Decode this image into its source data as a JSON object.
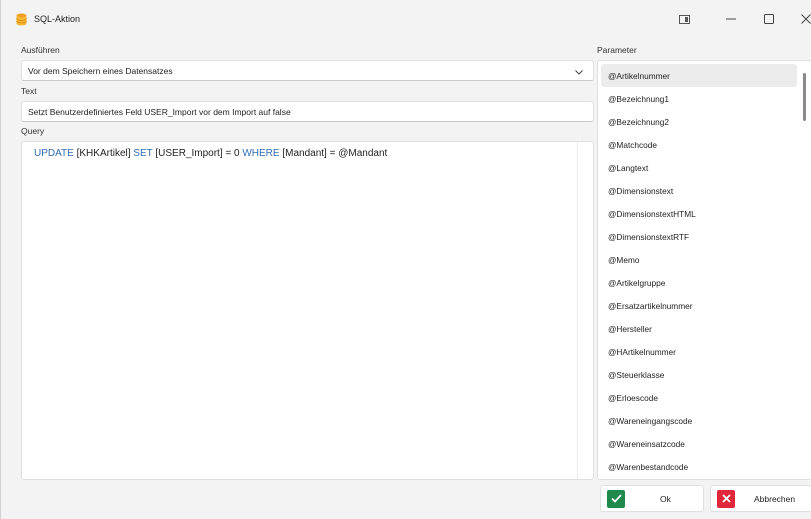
{
  "window": {
    "title": "SQL-Aktion",
    "app_icon": "database-icon",
    "controls": [
      "snap-layout-icon",
      "minimize-icon",
      "maximize-icon",
      "close-icon"
    ]
  },
  "execute": {
    "label": "Ausführen",
    "selected": "Vor dem Speichern eines Datensatzes"
  },
  "text": {
    "label": "Text",
    "value": "Setzt Benutzerdefiniertes Feld USER_Import vor dem Import auf false"
  },
  "query": {
    "label": "Query",
    "tokens": [
      {
        "t": "UPDATE",
        "kw": true
      },
      {
        "t": " [KHKArtikel] ",
        "kw": false
      },
      {
        "t": "SET",
        "kw": true
      },
      {
        "t": " [USER_Import] = 0 ",
        "kw": false
      },
      {
        "t": "WHERE",
        "kw": true
      },
      {
        "t": " [Mandant] = @Mandant",
        "kw": false
      }
    ],
    "keyword_color": "#2f6db5"
  },
  "parameters": {
    "label": "Parameter",
    "selected_index": 0,
    "items": [
      "@Artikelnummer",
      "@Bezeichnung1",
      "@Bezeichnung2",
      "@Matchcode",
      "@Langtext",
      "@Dimensionstext",
      "@DimensionstextHTML",
      "@DimensionstextRTF",
      "@Memo",
      "@Artikelgruppe",
      "@Ersatzartikelnummer",
      "@Hersteller",
      "@HArtikelnummer",
      "@Steuerklasse",
      "@Erloescode",
      "@Wareneingangscode",
      "@Wareneinsatzcode",
      "@Warenbestandcode"
    ]
  },
  "buttons": {
    "ok": {
      "label": "Ok",
      "icon": "check-icon",
      "color": "#1f8a4c"
    },
    "cancel": {
      "label": "Abbrechen",
      "icon": "x-icon",
      "color": "#e0283a"
    }
  }
}
